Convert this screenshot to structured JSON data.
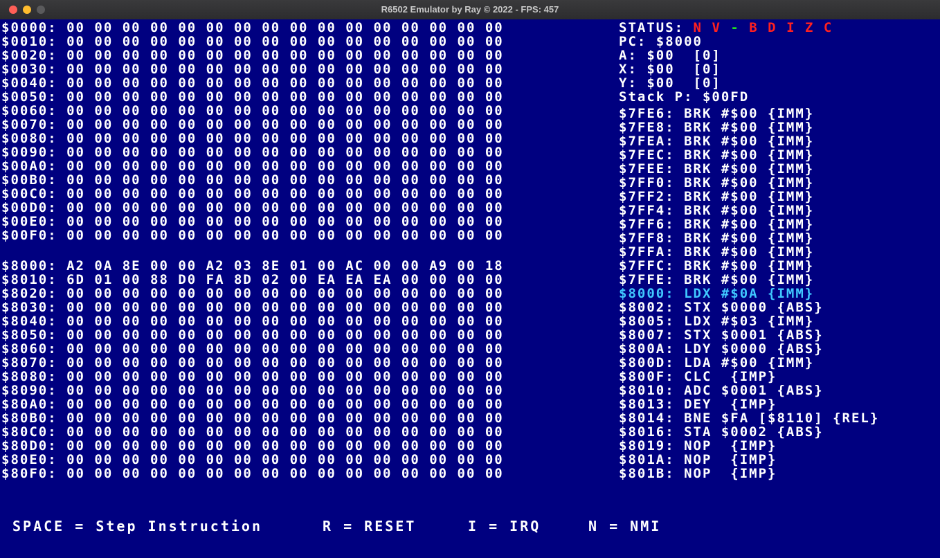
{
  "window": {
    "title": "R6502 Emulator by Ray © 2022 - FPS: 457"
  },
  "memory_page_0": [
    "$0000: 00 00 00 00 00 00 00 00 00 00 00 00 00 00 00 00",
    "$0010: 00 00 00 00 00 00 00 00 00 00 00 00 00 00 00 00",
    "$0020: 00 00 00 00 00 00 00 00 00 00 00 00 00 00 00 00",
    "$0030: 00 00 00 00 00 00 00 00 00 00 00 00 00 00 00 00",
    "$0040: 00 00 00 00 00 00 00 00 00 00 00 00 00 00 00 00",
    "$0050: 00 00 00 00 00 00 00 00 00 00 00 00 00 00 00 00",
    "$0060: 00 00 00 00 00 00 00 00 00 00 00 00 00 00 00 00",
    "$0070: 00 00 00 00 00 00 00 00 00 00 00 00 00 00 00 00",
    "$0080: 00 00 00 00 00 00 00 00 00 00 00 00 00 00 00 00",
    "$0090: 00 00 00 00 00 00 00 00 00 00 00 00 00 00 00 00",
    "$00A0: 00 00 00 00 00 00 00 00 00 00 00 00 00 00 00 00",
    "$00B0: 00 00 00 00 00 00 00 00 00 00 00 00 00 00 00 00",
    "$00C0: 00 00 00 00 00 00 00 00 00 00 00 00 00 00 00 00",
    "$00D0: 00 00 00 00 00 00 00 00 00 00 00 00 00 00 00 00",
    "$00E0: 00 00 00 00 00 00 00 00 00 00 00 00 00 00 00 00",
    "$00F0: 00 00 00 00 00 00 00 00 00 00 00 00 00 00 00 00"
  ],
  "memory_page_80": [
    "$8000: A2 0A 8E 00 00 A2 03 8E 01 00 AC 00 00 A9 00 18",
    "$8010: 6D 01 00 88 D0 FA 8D 02 00 EA EA EA 00 00 00 00",
    "$8020: 00 00 00 00 00 00 00 00 00 00 00 00 00 00 00 00",
    "$8030: 00 00 00 00 00 00 00 00 00 00 00 00 00 00 00 00",
    "$8040: 00 00 00 00 00 00 00 00 00 00 00 00 00 00 00 00",
    "$8050: 00 00 00 00 00 00 00 00 00 00 00 00 00 00 00 00",
    "$8060: 00 00 00 00 00 00 00 00 00 00 00 00 00 00 00 00",
    "$8070: 00 00 00 00 00 00 00 00 00 00 00 00 00 00 00 00",
    "$8080: 00 00 00 00 00 00 00 00 00 00 00 00 00 00 00 00",
    "$8090: 00 00 00 00 00 00 00 00 00 00 00 00 00 00 00 00",
    "$80A0: 00 00 00 00 00 00 00 00 00 00 00 00 00 00 00 00",
    "$80B0: 00 00 00 00 00 00 00 00 00 00 00 00 00 00 00 00",
    "$80C0: 00 00 00 00 00 00 00 00 00 00 00 00 00 00 00 00",
    "$80D0: 00 00 00 00 00 00 00 00 00 00 00 00 00 00 00 00",
    "$80E0: 00 00 00 00 00 00 00 00 00 00 00 00 00 00 00 00",
    "$80F0: 00 00 00 00 00 00 00 00 00 00 00 00 00 00 00 00"
  ],
  "status": {
    "label": "STATUS:",
    "flags": {
      "n": "N",
      "v": "V",
      "u": "-",
      "b": "B",
      "d": "D",
      "i": "I",
      "z": "Z",
      "c": "C"
    },
    "flag_colors": {
      "set": "#20e020",
      "clear": "#ff2020"
    },
    "pc": "PC: $8000",
    "a": "A: $00  [0]",
    "x": "X: $00  [0]",
    "y": "Y: $00  [0]",
    "stack": "Stack P: $00FD"
  },
  "disassembly": [
    "$7FE6: BRK #$00 {IMM}",
    "$7FE8: BRK #$00 {IMM}",
    "$7FEA: BRK #$00 {IMM}",
    "$7FEC: BRK #$00 {IMM}",
    "$7FEE: BRK #$00 {IMM}",
    "$7FF0: BRK #$00 {IMM}",
    "$7FF2: BRK #$00 {IMM}",
    "$7FF4: BRK #$00 {IMM}",
    "$7FF6: BRK #$00 {IMM}",
    "$7FF8: BRK #$00 {IMM}",
    "$7FFA: BRK #$00 {IMM}",
    "$7FFC: BRK #$00 {IMM}",
    "$7FFE: BRK #$00 {IMM}",
    "$8000: LDX #$0A {IMM}",
    "$8002: STX $0000 {ABS}",
    "$8005: LDX #$03 {IMM}",
    "$8007: STX $0001 {ABS}",
    "$800A: LDY $0000 {ABS}",
    "$800D: LDA #$00 {IMM}",
    "$800F: CLC  {IMP}",
    "$8010: ADC $0001 {ABS}",
    "$8013: DEY  {IMP}",
    "$8014: BNE $FA [$8110] {REL}",
    "$8016: STA $0002 {ABS}",
    "$8019: NOP  {IMP}",
    "$801A: NOP  {IMP}",
    "$801B: NOP  {IMP}"
  ],
  "current_instruction_color": "#40c8ff",
  "help": {
    "step": "SPACE = Step Instruction",
    "reset": "R = RESET",
    "irq": "I = IRQ",
    "nmi": "N = NMI"
  }
}
